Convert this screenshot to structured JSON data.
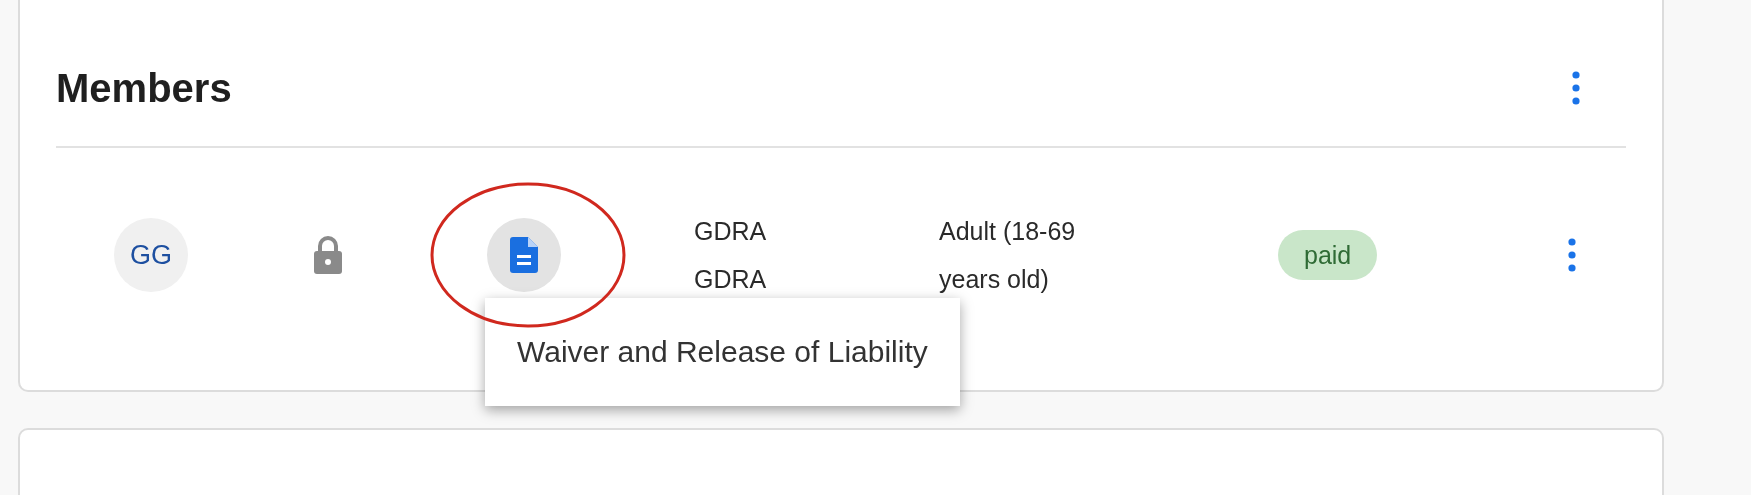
{
  "card": {
    "title": "Members"
  },
  "members": [
    {
      "initials": "GG",
      "locked": true,
      "highlighted": true,
      "tooltip": "Waiver and Release of Liability",
      "name": "GDRA GDRA",
      "category": "Adult (18-69 years old)",
      "status": "paid"
    }
  ]
}
